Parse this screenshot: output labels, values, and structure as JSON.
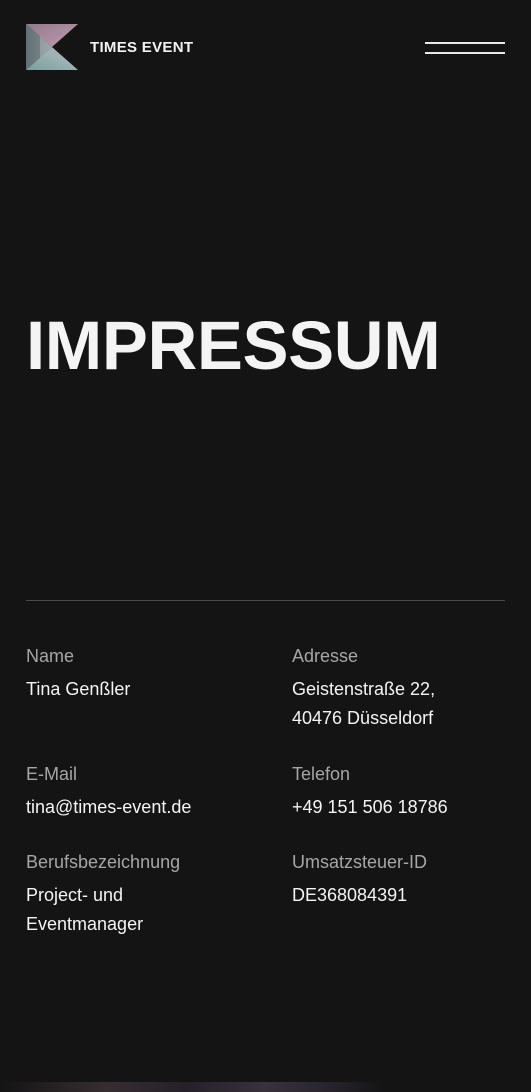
{
  "header": {
    "brand_name": "TIMES EVENT",
    "logo_icon": "hourglass-logo-icon",
    "menu_icon": "hamburger-menu-icon"
  },
  "hero": {
    "title": "IMPRESSUM"
  },
  "details": {
    "name": {
      "label": "Name",
      "value": "Tina Genßler"
    },
    "address": {
      "label": "Adresse",
      "value": "Geistenstraße 22,\n40476 Düsseldorf"
    },
    "email": {
      "label": "E-Mail",
      "value": "tina@times-event.de"
    },
    "phone": {
      "label": "Telefon",
      "value": "+49 151 506 18786"
    },
    "occupation": {
      "label": "Berufsbezeichnung",
      "value": "Project- und\nEventmanager"
    },
    "vat": {
      "label": "Umsatzsteuer-ID",
      "value": "DE368084391"
    }
  },
  "colors": {
    "background": "#141415",
    "text": "#f4f4f4",
    "muted": "#a6a6a8",
    "divider": "#4a4a4c",
    "logo_top": "#b58aa0",
    "logo_bottom": "#7fa3a8"
  }
}
